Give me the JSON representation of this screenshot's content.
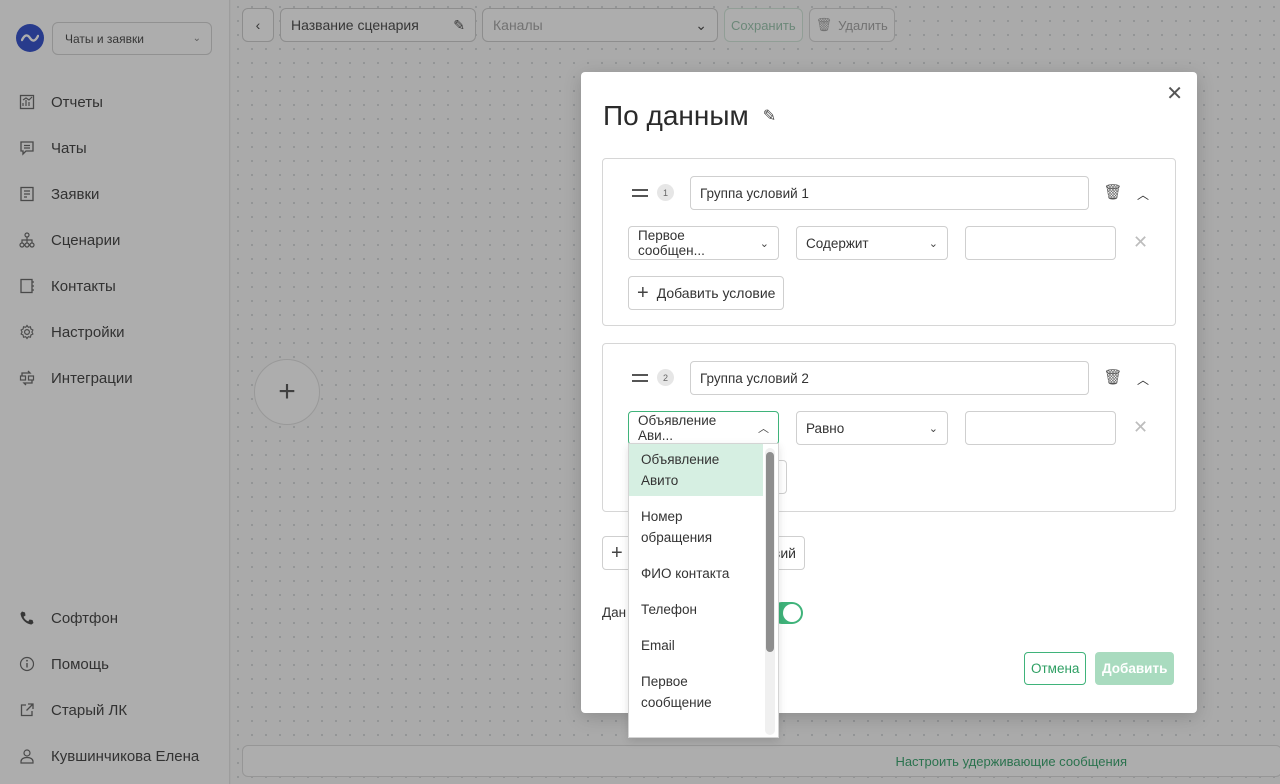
{
  "sidebar": {
    "workspace": "Чаты и заявки",
    "nav": [
      {
        "label": "Отчеты",
        "icon": "reports-icon"
      },
      {
        "label": "Чаты",
        "icon": "chat-icon"
      },
      {
        "label": "Заявки",
        "icon": "requests-icon"
      },
      {
        "label": "Сценарии",
        "icon": "scenarios-icon"
      },
      {
        "label": "Контакты",
        "icon": "contacts-icon"
      },
      {
        "label": "Настройки",
        "icon": "gear-icon"
      },
      {
        "label": "Интеграции",
        "icon": "integrations-icon"
      }
    ],
    "bottom": [
      {
        "label": "Софтфон",
        "icon": "phone-icon"
      },
      {
        "label": "Помощь",
        "icon": "info-icon"
      },
      {
        "label": "Старый ЛК",
        "icon": "external-link-icon"
      },
      {
        "label": "Кувшинчикова Елена",
        "icon": "user-icon"
      }
    ]
  },
  "toolbar": {
    "scenario_name": "Название сценария",
    "channels_placeholder": "Каналы",
    "save_label": "Сохранить",
    "delete_label": "Удалить"
  },
  "canvas": {
    "bottom_link": "Настроить удерживающие сообщения"
  },
  "modal": {
    "title": "По данным",
    "groups": [
      {
        "number": "1",
        "name": "Группа условий 1",
        "field": "Первое сообщен...",
        "operator": "Содержит",
        "value": "",
        "add_condition": "Добавить условие"
      },
      {
        "number": "2",
        "name": "Группа условий 2",
        "field": "Объявление Ави...",
        "operator": "Равно",
        "value": ""
      }
    ],
    "add_group_partial": "вий",
    "toggle_label_partial": "Дан",
    "toggle_on": true,
    "cancel_label": "Отмена",
    "add_label": "Добавить"
  },
  "dropdown": {
    "options": [
      "Объявление Авито",
      "Номер обращения",
      "ФИО контакта",
      "Телефон",
      "Email",
      "Первое сообщение"
    ],
    "selected": "Объявление Авито"
  },
  "colors": {
    "accent": "#3fb37a",
    "brand": "#1a3bc7",
    "selected_bg": "#d6efe2"
  }
}
